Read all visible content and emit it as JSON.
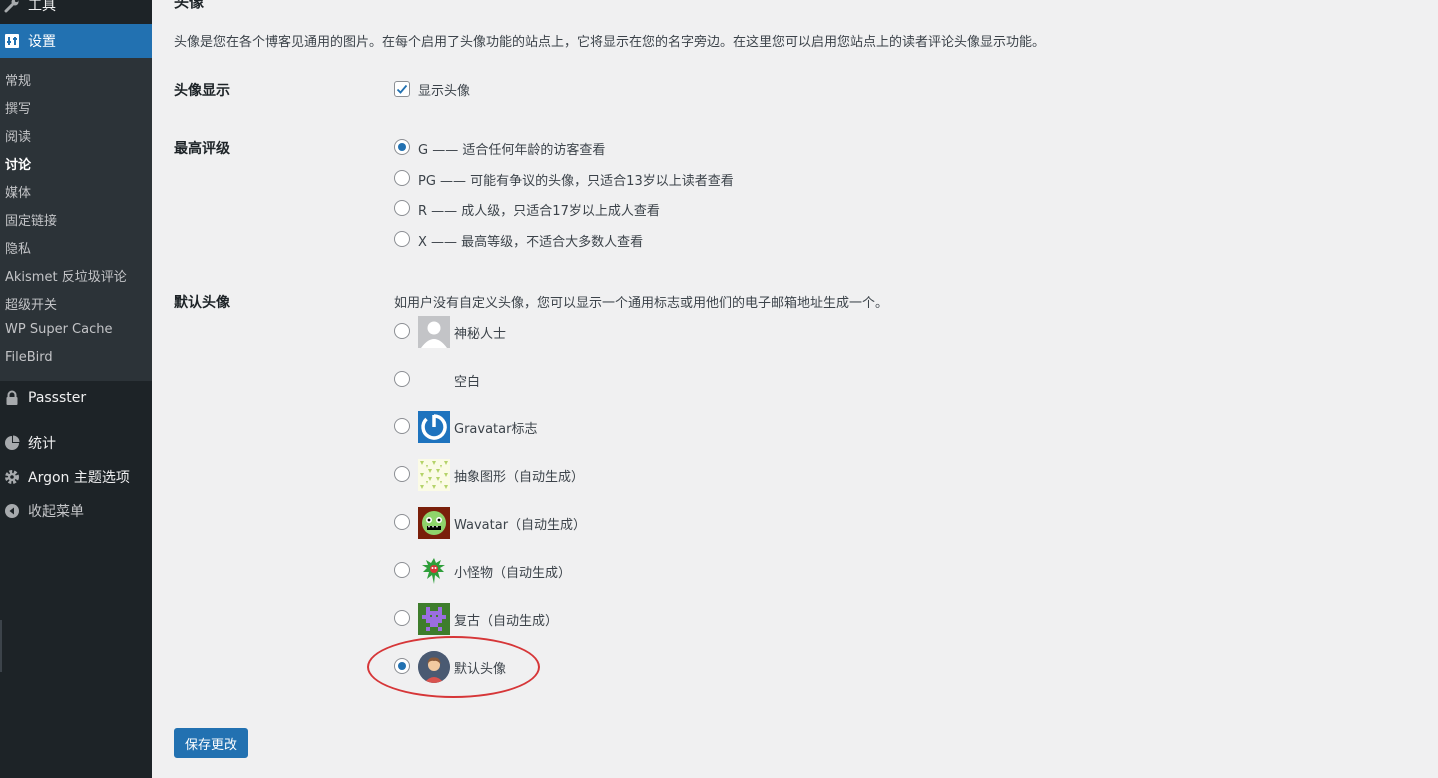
{
  "sidebar": {
    "tools_label": "工具",
    "settings_label": "设置",
    "submenu": [
      "常规",
      "撰写",
      "阅读",
      "讨论",
      "媒体",
      "固定链接",
      "隐私",
      "Akismet 反垃圾评论",
      "超级开关",
      "WP Super Cache",
      "FileBird"
    ],
    "current_submenu": "讨论",
    "passster_label": "Passster",
    "stats_label": "统计",
    "argon_label": "Argon 主题选项",
    "collapse_label": "收起菜单"
  },
  "section": {
    "title": "头像",
    "description": "头像是您在各个博客见通用的图片。在每个启用了头像功能的站点上，它将显示在您的名字旁边。在这里您可以启用您站点上的读者评论头像显示功能。"
  },
  "avatar_display": {
    "label": "头像显示",
    "checkbox_label": "显示头像",
    "checked": true
  },
  "max_rating": {
    "label": "最高评级",
    "options": [
      {
        "label": "G —— 适合任何年龄的访客查看",
        "checked": true
      },
      {
        "label": "PG —— 可能有争议的头像，只适合13岁以上读者查看",
        "checked": false
      },
      {
        "label": "R —— 成人级，只适合17岁以上成人查看",
        "checked": false
      },
      {
        "label": "X —— 最高等级，不适合大多数人查看",
        "checked": false
      }
    ]
  },
  "default_avatar": {
    "label": "默认头像",
    "description": "如用户没有自定义头像，您可以显示一个通用标志或用他们的电子邮箱地址生成一个。",
    "options": [
      {
        "label": "神秘人士",
        "icon": "mystery-person-avatar",
        "checked": false
      },
      {
        "label": "空白",
        "icon": "blank-avatar",
        "checked": false
      },
      {
        "label": "Gravatar标志",
        "icon": "gravatar-logo-avatar",
        "checked": false
      },
      {
        "label": "抽象图形（自动生成）",
        "icon": "identicon-avatar",
        "checked": false
      },
      {
        "label": "Wavatar（自动生成）",
        "icon": "wavatar-avatar",
        "checked": false
      },
      {
        "label": "小怪物（自动生成）",
        "icon": "monsterid-avatar",
        "checked": false
      },
      {
        "label": "复古（自动生成）",
        "icon": "retro-avatar",
        "checked": false
      },
      {
        "label": "默认头像",
        "icon": "custom-default-avatar",
        "checked": true
      }
    ]
  },
  "save_label": "保存更改",
  "colors": {
    "sidebar_bg": "#1d2327",
    "submenu_bg": "#2c3338",
    "accent": "#2271b1",
    "highlight": "#d63638",
    "page_bg": "#f0f0f1"
  }
}
